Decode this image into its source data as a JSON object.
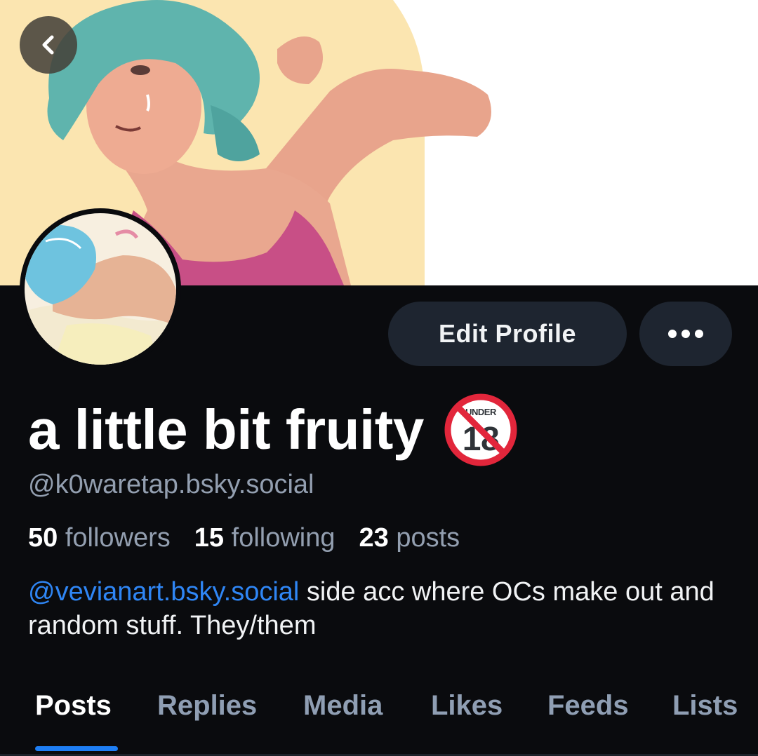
{
  "header": {
    "back_icon": "chevron-left-icon"
  },
  "banner": {
    "description_icon": "banner-illustration"
  },
  "profile": {
    "display_name": "a little bit fruity",
    "badge": {
      "icon": "no-under-18-icon",
      "label": "UNDER",
      "number": "18"
    },
    "handle": "@k0waretap.bsky.social",
    "stats": {
      "followers_count": "50",
      "followers_label": "followers",
      "following_count": "15",
      "following_label": "following",
      "posts_count": "23",
      "posts_label": "posts"
    },
    "bio": {
      "mention": "@vevianart.bsky.social",
      "text": " side acc where OCs make out and random stuff. They/them"
    }
  },
  "actions": {
    "edit_label": "Edit Profile",
    "more_icon": "ellipsis-icon"
  },
  "tabs": [
    {
      "label": "Posts",
      "active": true
    },
    {
      "label": "Replies",
      "active": false
    },
    {
      "label": "Media",
      "active": false
    },
    {
      "label": "Likes",
      "active": false
    },
    {
      "label": "Feeds",
      "active": false
    },
    {
      "label": "Lists",
      "active": false
    }
  ],
  "colors": {
    "background": "#0a0b0e",
    "button_bg": "#1e2530",
    "muted_text": "#939fb0",
    "link": "#2f86f5",
    "tab_indicator": "#1e7ef4"
  }
}
